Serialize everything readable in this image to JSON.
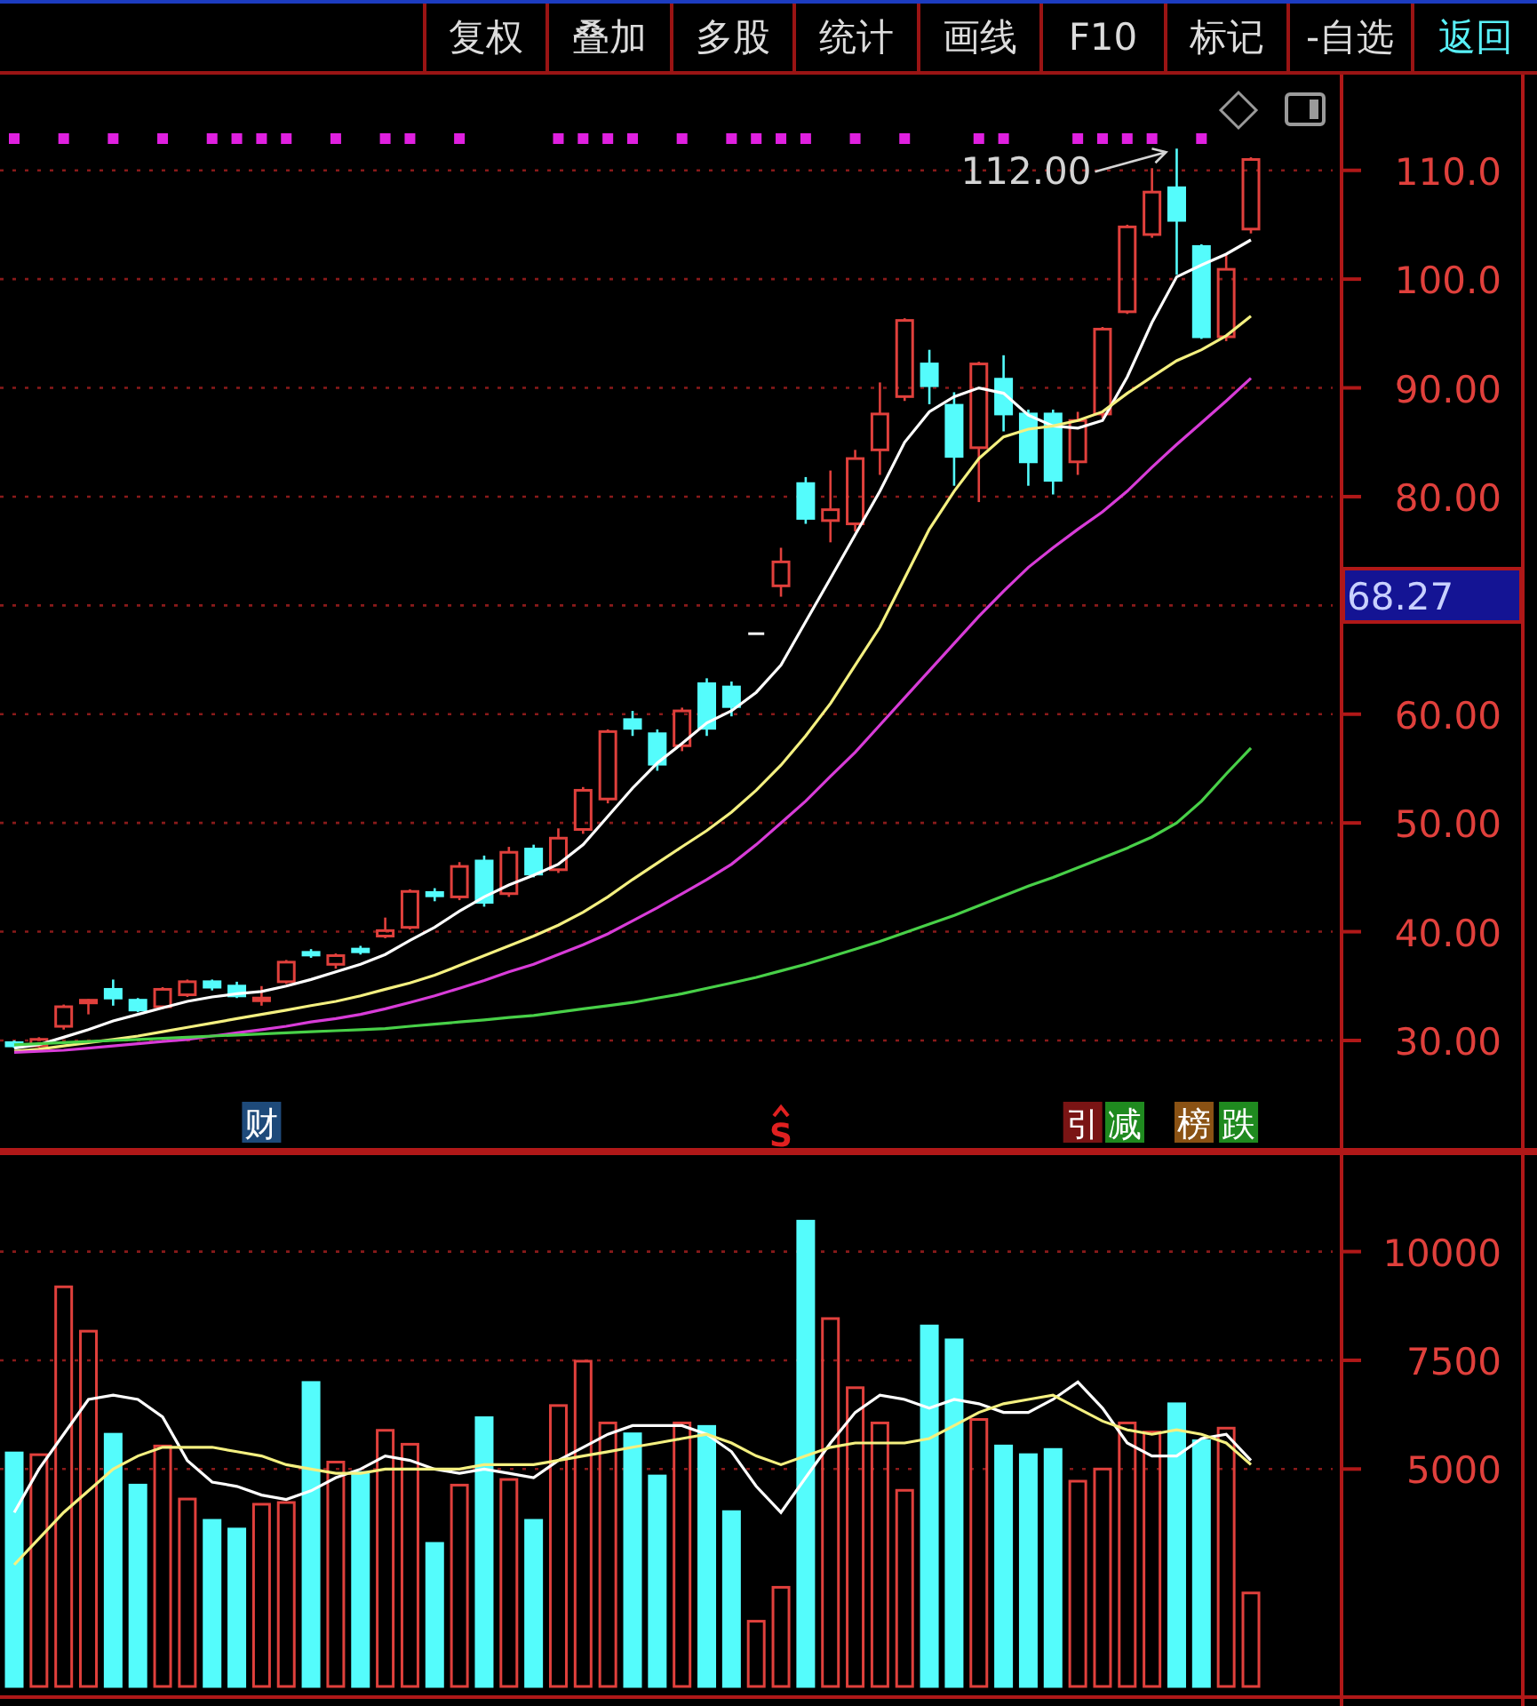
{
  "toolbar": [
    {
      "label": "复权",
      "highlighted": false
    },
    {
      "label": "叠加",
      "highlighted": false
    },
    {
      "label": "多股",
      "highlighted": false
    },
    {
      "label": "统计",
      "highlighted": false
    },
    {
      "label": "画线",
      "highlighted": false
    },
    {
      "label": "F10",
      "highlighted": false
    },
    {
      "label": "标记",
      "highlighted": false
    },
    {
      "label": "-自选",
      "highlighted": false
    },
    {
      "label": "返回",
      "highlighted": true
    }
  ],
  "price_panel": {
    "current_price": "68.27",
    "signal_dots": [
      true,
      false,
      true,
      false,
      true,
      false,
      true,
      false,
      true,
      true,
      true,
      true,
      false,
      true,
      false,
      true,
      true,
      false,
      true,
      false,
      false,
      false,
      true,
      true,
      true,
      true,
      false,
      true,
      false,
      true,
      true,
      true,
      true,
      false,
      true,
      false,
      true,
      false,
      false,
      true,
      true,
      false,
      false,
      true,
      true,
      true,
      true,
      false,
      true,
      false,
      false
    ],
    "event_tags": [
      {
        "kind": "tag",
        "text": "财",
        "color": "#1e4a7a"
      },
      {
        "kind": "mark",
        "text": "S",
        "color": "#e02020"
      },
      {
        "kind": "tag",
        "text": "引",
        "color": "#7a1414"
      },
      {
        "kind": "tag",
        "text": "减",
        "color": "#1f8a1f"
      },
      {
        "kind": "tag",
        "text": "榜",
        "color": "#8a5214"
      },
      {
        "kind": "tag",
        "text": "跌",
        "color": "#1f8a1f"
      }
    ],
    "chart_data": {
      "type": "candlestick",
      "ylim": [
        19.95,
        118.8
      ],
      "grid": true,
      "yticks": [
        {
          "value": 30,
          "label": "30.00"
        },
        {
          "value": 40,
          "label": "40.00"
        },
        {
          "value": 50,
          "label": "50.00"
        },
        {
          "value": 60,
          "label": "60.00"
        },
        {
          "value": 80,
          "label": "80.00"
        },
        {
          "value": 90,
          "label": "90.00"
        },
        {
          "value": 100,
          "label": "100.0"
        },
        {
          "value": 110,
          "label": "110.0"
        }
      ],
      "ohlc": [
        [
          29.8,
          30.0,
          29.3,
          29.5
        ],
        [
          29.5,
          30.3,
          29.3,
          30.1
        ],
        [
          31.3,
          33.3,
          31.0,
          33.1
        ],
        [
          33.6,
          33.8,
          32.4,
          33.7
        ],
        [
          34.7,
          35.6,
          33.2,
          33.9
        ],
        [
          33.7,
          33.9,
          32.6,
          32.8
        ],
        [
          33.1,
          34.9,
          32.9,
          34.7
        ],
        [
          34.2,
          35.6,
          34.0,
          35.4
        ],
        [
          35.4,
          35.6,
          34.6,
          34.9
        ],
        [
          35.0,
          35.4,
          33.9,
          34.1
        ],
        [
          33.8,
          35.0,
          33.2,
          33.9
        ],
        [
          35.4,
          37.4,
          35.2,
          37.2
        ],
        [
          38.1,
          38.4,
          37.6,
          37.9
        ],
        [
          37.0,
          38.0,
          36.6,
          37.8
        ],
        [
          38.4,
          38.7,
          37.9,
          38.2
        ],
        [
          39.6,
          41.3,
          39.4,
          40.1
        ],
        [
          40.4,
          43.9,
          40.2,
          43.7
        ],
        [
          43.6,
          44.0,
          42.8,
          43.3
        ],
        [
          43.2,
          46.4,
          42.9,
          46.0
        ],
        [
          46.5,
          47.0,
          42.3,
          42.7
        ],
        [
          43.5,
          47.8,
          43.2,
          47.3
        ],
        [
          47.6,
          48.0,
          45.0,
          45.3
        ],
        [
          45.7,
          49.5,
          45.4,
          48.6
        ],
        [
          49.4,
          53.3,
          49.0,
          53.0
        ],
        [
          52.2,
          58.6,
          51.8,
          58.4
        ],
        [
          59.5,
          60.3,
          58.0,
          58.7
        ],
        [
          58.2,
          58.6,
          54.8,
          55.4
        ],
        [
          57.1,
          60.6,
          56.6,
          60.3
        ],
        [
          62.8,
          63.3,
          58.0,
          58.7
        ],
        [
          62.5,
          63.0,
          59.8,
          60.7
        ],
        [
          67.4,
          67.4,
          67.4,
          67.4
        ],
        [
          71.8,
          75.3,
          70.8,
          74.0
        ],
        [
          81.2,
          81.8,
          77.5,
          78.0
        ],
        [
          77.8,
          82.4,
          75.8,
          78.8
        ],
        [
          77.5,
          84.3,
          76.8,
          83.5
        ],
        [
          84.3,
          90.5,
          82.0,
          87.6
        ],
        [
          89.2,
          96.4,
          88.8,
          96.2
        ],
        [
          92.2,
          93.5,
          88.5,
          90.2
        ],
        [
          88.4,
          89.6,
          81.0,
          83.7
        ],
        [
          84.5,
          92.4,
          79.5,
          92.2
        ],
        [
          90.8,
          93.0,
          86.0,
          87.6
        ],
        [
          87.6,
          88.0,
          81.0,
          83.2
        ],
        [
          87.6,
          88.0,
          80.2,
          81.5
        ],
        [
          83.2,
          87.8,
          82.0,
          87.0
        ],
        [
          87.6,
          95.6,
          87.2,
          95.4
        ],
        [
          97.0,
          105.0,
          96.8,
          104.8
        ],
        [
          104.1,
          110.2,
          103.8,
          108.0
        ],
        [
          108.4,
          112.0,
          100.4,
          105.4
        ],
        [
          103.0,
          103.2,
          94.5,
          94.7
        ],
        [
          94.7,
          102.3,
          94.3,
          100.9
        ],
        [
          104.6,
          111.2,
          104.2,
          111.0
        ]
      ],
      "series": [
        {
          "type": "line",
          "color": "#ffffff",
          "values": [
            29.3,
            29.6,
            30.3,
            31.0,
            31.8,
            32.4,
            33.0,
            33.6,
            34.0,
            34.3,
            34.5,
            35.0,
            35.6,
            36.3,
            37.0,
            37.9,
            39.2,
            40.4,
            41.9,
            43.2,
            44.3,
            45.2,
            46.2,
            48.0,
            50.6,
            53.2,
            55.5,
            57.3,
            59.2,
            60.3,
            62.0,
            64.5,
            68.5,
            72.5,
            76.5,
            80.5,
            85.0,
            87.8,
            89.2,
            90.0,
            89.5,
            87.5,
            86.5,
            86.3,
            87.0,
            91.0,
            96.0,
            100.2,
            101.3,
            102.3,
            103.6
          ]
        },
        {
          "type": "line",
          "color": "#f4f080",
          "values": [
            29.0,
            29.2,
            29.5,
            29.8,
            30.1,
            30.4,
            30.8,
            31.2,
            31.6,
            32.0,
            32.4,
            32.8,
            33.2,
            33.6,
            34.1,
            34.7,
            35.3,
            36.0,
            36.9,
            37.8,
            38.7,
            39.6,
            40.6,
            41.8,
            43.2,
            44.8,
            46.3,
            47.8,
            49.3,
            51.0,
            53.0,
            55.3,
            58.0,
            61.0,
            64.5,
            68.0,
            72.5,
            77.0,
            80.5,
            83.5,
            85.5,
            86.2,
            86.5,
            87.0,
            87.8,
            89.5,
            91.0,
            92.5,
            93.5,
            94.8,
            96.6
          ]
        },
        {
          "type": "line",
          "color": "#d83cd8",
          "values": [
            28.9,
            29.0,
            29.1,
            29.3,
            29.5,
            29.7,
            29.9,
            30.1,
            30.4,
            30.7,
            31.0,
            31.3,
            31.7,
            32.0,
            32.4,
            32.9,
            33.5,
            34.1,
            34.8,
            35.5,
            36.3,
            37.0,
            37.9,
            38.8,
            39.8,
            41.0,
            42.2,
            43.5,
            44.8,
            46.2,
            48.0,
            50.0,
            52.0,
            54.3,
            56.5,
            59.0,
            61.5,
            64.0,
            66.5,
            69.0,
            71.3,
            73.5,
            75.3,
            77.0,
            78.6,
            80.5,
            82.7,
            84.8,
            86.8,
            88.8,
            90.9
          ]
        },
        {
          "type": "line",
          "color": "#48d048",
          "values": [
            29.6,
            29.7,
            29.8,
            29.9,
            30.0,
            30.1,
            30.2,
            30.3,
            30.4,
            30.5,
            30.6,
            30.7,
            30.8,
            30.9,
            31.0,
            31.1,
            31.3,
            31.5,
            31.7,
            31.9,
            32.1,
            32.3,
            32.6,
            32.9,
            33.2,
            33.5,
            33.9,
            34.3,
            34.8,
            35.3,
            35.8,
            36.4,
            37.0,
            37.7,
            38.4,
            39.1,
            39.9,
            40.7,
            41.5,
            42.4,
            43.3,
            44.2,
            45.0,
            45.9,
            46.8,
            47.7,
            48.7,
            50.0,
            52.0,
            54.5,
            56.9
          ]
        }
      ],
      "annotations": [
        "112.00"
      ]
    }
  },
  "volume_panel": {
    "chart_data": {
      "type": "bar",
      "ylim": [
        0,
        12260
      ],
      "grid": true,
      "yticks": [
        {
          "value": 5000,
          "label": "5000"
        },
        {
          "value": 7500,
          "label": "7500"
        },
        {
          "value": 10000,
          "label": "10000"
        }
      ],
      "series": [
        {
          "colors": [
            "#54fcfc",
            "#e0403c",
            "#e0403c",
            "#e0403c",
            "#54fcfc",
            "#54fcfc",
            "#e0403c",
            "#e0403c",
            "#54fcfc",
            "#54fcfc",
            "#e0403c",
            "#e0403c",
            "#54fcfc",
            "#e0403c",
            "#54fcfc",
            "#e0403c",
            "#e0403c",
            "#54fcfc",
            "#e0403c",
            "#54fcfc",
            "#e0403c",
            "#54fcfc",
            "#e0403c",
            "#e0403c",
            "#e0403c",
            "#54fcfc",
            "#54fcfc",
            "#e0403c",
            "#54fcfc",
            "#54fcfc",
            "#e0403c",
            "#e0403c",
            "#54fcfc",
            "#e0403c",
            "#e0403c",
            "#e0403c",
            "#e0403c",
            "#54fcfc",
            "#54fcfc",
            "#e0403c",
            "#54fcfc",
            "#54fcfc",
            "#54fcfc",
            "#e0403c",
            "#e0403c",
            "#e0403c",
            "#e0403c",
            "#54fcfc",
            "#54fcfc",
            "#e0403c",
            "#e0403c"
          ],
          "values": [
            5370,
            5330,
            9190,
            8170,
            5800,
            4630,
            5530,
            4310,
            3820,
            3620,
            4190,
            4230,
            6990,
            5160,
            4920,
            5890,
            5570,
            3290,
            4630,
            6180,
            4760,
            3820,
            6460,
            7480,
            6060,
            5810,
            4840,
            6060,
            5980,
            4020,
            1500,
            2280,
            10700,
            8460,
            6870,
            6060,
            4510,
            8290,
            7970,
            6140,
            5530,
            5330,
            5450,
            4720,
            5000,
            6060,
            5850,
            6500,
            5650,
            5940,
            2150
          ]
        },
        {
          "type": "line",
          "color": "#ffffff",
          "values": [
            4000,
            5000,
            5800,
            6600,
            6700,
            6600,
            6200,
            5200,
            4700,
            4600,
            4400,
            4300,
            4500,
            4800,
            5000,
            5300,
            5200,
            5000,
            4900,
            5000,
            4900,
            4800,
            5200,
            5500,
            5800,
            6000,
            6000,
            6000,
            5800,
            5400,
            4600,
            4000,
            4800,
            5600,
            6300,
            6700,
            6600,
            6400,
            6600,
            6500,
            6300,
            6300,
            6600,
            7000,
            6400,
            5600,
            5300,
            5300,
            5700,
            5800,
            5200
          ]
        },
        {
          "type": "line",
          "color": "#f4f080",
          "values": [
            2800,
            3400,
            4000,
            4500,
            5000,
            5300,
            5500,
            5500,
            5500,
            5400,
            5300,
            5100,
            5000,
            4900,
            4900,
            5000,
            5000,
            5000,
            5000,
            5100,
            5100,
            5100,
            5200,
            5300,
            5400,
            5500,
            5600,
            5700,
            5800,
            5600,
            5300,
            5100,
            5300,
            5500,
            5600,
            5600,
            5600,
            5700,
            6000,
            6300,
            6500,
            6600,
            6700,
            6400,
            6100,
            5900,
            5800,
            5900,
            5800,
            5600,
            5100
          ]
        }
      ]
    }
  }
}
